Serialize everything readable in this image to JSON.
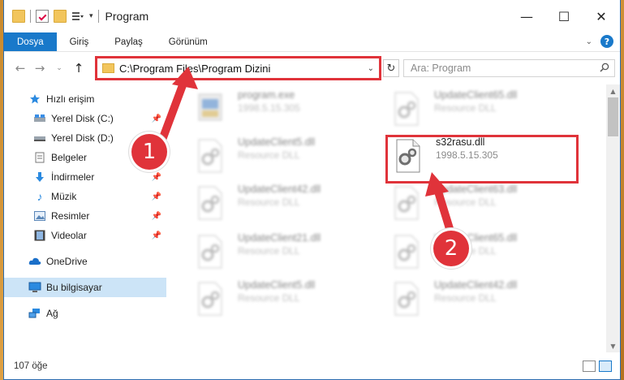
{
  "window": {
    "title": "Program",
    "controls": {
      "minimize": "—",
      "maximize": "☐",
      "close": "✕"
    }
  },
  "ribbon": {
    "tabs": [
      "Dosya",
      "Giriş",
      "Paylaş",
      "Görünüm"
    ],
    "active_tab": "Dosya",
    "accent_color": "#1979ca"
  },
  "address_bar": {
    "path": "C:\\Program Files\\Program Dizini",
    "highlight_color": "#e0333a"
  },
  "search": {
    "placeholder": "Ara: Program"
  },
  "sidebar": {
    "items": [
      {
        "label": "Hızlı erişim",
        "icon": "star-icon"
      },
      {
        "label": "Yerel Disk (C:)",
        "icon": "drive-icon",
        "pinned": true
      },
      {
        "label": "Yerel Disk (D:)",
        "icon": "drive-icon",
        "pinned": false
      },
      {
        "label": "Belgeler",
        "icon": "documents-icon",
        "pinned": true
      },
      {
        "label": "İndirmeler",
        "icon": "download-icon",
        "pinned": true
      },
      {
        "label": "Müzik",
        "icon": "music-icon",
        "pinned": true
      },
      {
        "label": "Resimler",
        "icon": "pictures-icon",
        "pinned": true
      },
      {
        "label": "Videolar",
        "icon": "video-icon",
        "pinned": true
      },
      {
        "label": "OneDrive",
        "icon": "cloud-icon"
      },
      {
        "label": "Bu bilgisayar",
        "icon": "computer-icon",
        "selected": true
      },
      {
        "label": "Ağ",
        "icon": "network-icon"
      }
    ]
  },
  "files": [
    {
      "name": "program.exe",
      "sub": "1998.5.15.305",
      "blurred": true
    },
    {
      "name": "UpdateClient65.dll",
      "sub": "Resource DLL",
      "blurred": true
    },
    {
      "name": "UpdateClient5.dll",
      "sub": "Resource DLL",
      "blurred": true
    },
    {
      "name": "s32rasu.dll",
      "sub": "1998.5.15.305",
      "blurred": false
    },
    {
      "name": "UpdateClient42.dll",
      "sub": "Resource DLL",
      "blurred": true
    },
    {
      "name": "UpdateClient63.dll",
      "sub": "Resource DLL",
      "blurred": true
    },
    {
      "name": "UpdateClient21.dll",
      "sub": "Resource DLL",
      "blurred": true
    },
    {
      "name": "UpdateClient65.dll",
      "sub": "Resource DLL",
      "blurred": true
    },
    {
      "name": "UpdateClient5.dll",
      "sub": "Resource DLL",
      "blurred": true
    },
    {
      "name": "UpdateClient42.dll",
      "sub": "Resource DLL",
      "blurred": true
    }
  ],
  "status": {
    "item_count": "107 öğe"
  },
  "annotations": {
    "badge_1": "1",
    "badge_2": "2",
    "color": "#e0333a"
  }
}
